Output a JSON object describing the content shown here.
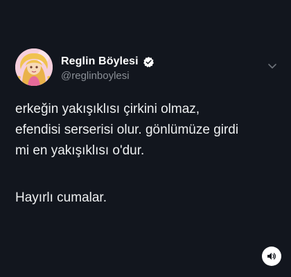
{
  "author": {
    "display_name": "Reglin Böylesi",
    "handle": "@reglinboylesi",
    "verified": true,
    "avatar_icon": "cartoon-girl-avatar"
  },
  "tweet": {
    "lines": [
      "erkeğin yakışıklısı çirkini olmaz,",
      "efendisi serserisi olur. gönlümüze girdi",
      "mi en yakışıklısı o'dur.",
      "Hayırlı cumalar."
    ]
  },
  "icons": {
    "verified": "verified-badge-icon",
    "more": "chevron-down-icon",
    "sound": "speaker-icon"
  },
  "colors": {
    "background": "#12161e",
    "text": "#eef0f1",
    "handle": "#8a8f96"
  }
}
